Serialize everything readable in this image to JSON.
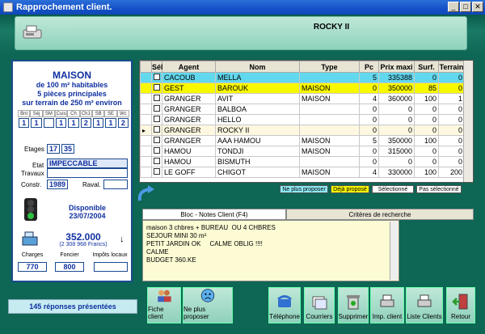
{
  "window": {
    "title": "Rapprochement client.",
    "min": "_",
    "max": "□",
    "close": "✕"
  },
  "header": {
    "title": "ROCKY II"
  },
  "property": {
    "type": "MAISON",
    "line1": "de 100 m² habitables",
    "line2": "5 pièces principales",
    "line3": "sur terrain de 250 m² environ",
    "room_headers": [
      "Bnt",
      "Séj",
      "SM",
      "Cuis",
      "Ch",
      "Ch1",
      "SB",
      "SE",
      "Wc"
    ],
    "room_values": [
      "1",
      "1",
      "",
      "1",
      "1",
      "2",
      "1",
      "1",
      "2"
    ],
    "etages_label": "Etages",
    "etages": [
      "17",
      "35"
    ],
    "etat_label": "Etat",
    "etat": "IMPECCABLE",
    "travaux_label": "Travaux",
    "constr_label": "Constr.",
    "constr": "1989",
    "raval_label": "Raval.",
    "dispo_label": "Disponible",
    "dispo_date": "23/07/2004",
    "price": "352.000",
    "price_francs": "(2 308 968 Francs)",
    "charges_label": "Charges",
    "charges": "770",
    "foncier_label": "Foncier",
    "foncier": "800",
    "impots_label": "Impôts locaux",
    "impots": ""
  },
  "grid": {
    "columns": [
      "Sél",
      "Agent",
      "Nom",
      "Type",
      "Pc",
      "Prix maxi",
      "Surf.",
      "Terrain"
    ],
    "rows": [
      {
        "agent": "CACOUB",
        "nom": "MELLA",
        "type": "",
        "pc": "5",
        "prix": "335388",
        "surf": "0",
        "terrain": "0",
        "bg": "#62d8ee"
      },
      {
        "agent": "GEST",
        "nom": "BAROUK",
        "type": "MAISON",
        "pc": "0",
        "prix": "350000",
        "surf": "85",
        "terrain": "0",
        "bg": "#f8f800"
      },
      {
        "agent": "GRANGER",
        "nom": "AVIT",
        "type": "MAISON",
        "pc": "4",
        "prix": "360000",
        "surf": "100",
        "terrain": "1",
        "bg": "#ffffff"
      },
      {
        "agent": "GRANGER",
        "nom": "BALBOA",
        "type": "",
        "pc": "0",
        "prix": "0",
        "surf": "0",
        "terrain": "0",
        "bg": "#ffffff"
      },
      {
        "agent": "GRANGER",
        "nom": "HELLO",
        "type": "",
        "pc": "0",
        "prix": "0",
        "surf": "0",
        "terrain": "0",
        "bg": "#ffffff"
      },
      {
        "agent": "GRANGER",
        "nom": "ROCKY II",
        "type": "",
        "pc": "0",
        "prix": "0",
        "surf": "0",
        "terrain": "0",
        "bg": "#fff8e0"
      },
      {
        "agent": "GRANGER",
        "nom": "AAA HAMOU",
        "type": "MAISON",
        "pc": "5",
        "prix": "350000",
        "surf": "100",
        "terrain": "0",
        "bg": "#ffffff"
      },
      {
        "agent": "HAMOU",
        "nom": "TONDJI",
        "type": "MAISON",
        "pc": "0",
        "prix": "315000",
        "surf": "0",
        "terrain": "0",
        "bg": "#ffffff"
      },
      {
        "agent": "HAMOU",
        "nom": "BISMUTH",
        "type": "",
        "pc": "0",
        "prix": "0",
        "surf": "0",
        "terrain": "0",
        "bg": "#ffffff"
      },
      {
        "agent": "LE GOFF",
        "nom": "CHIGOT",
        "type": "MAISON",
        "pc": "4",
        "prix": "330000",
        "surf": "100",
        "terrain": "200",
        "bg": "#ffffff"
      }
    ]
  },
  "legend": {
    "a": "Ne plus proposer",
    "b": "Déjà proposé",
    "c": "Sélectionné",
    "d": "Pas sélectionné"
  },
  "tabs": {
    "notes": "Bloc - Notes Client (F4)",
    "criteres": "Critères de recherche"
  },
  "notes": "maison 3 chbres + BUREAU  OU 4 CHBRES\nSEJOUR MINI 30 m²\nPETIT JARDIN OK     CALME OBLIG !!!!\nCALME\nBUDGET 360.KE",
  "status": "145 réponses présentées",
  "buttons": {
    "fiche": "Fiche client",
    "neplus": "Ne plus proposer",
    "tel": "Téléphone",
    "courrier": "Courriers",
    "suppr": "Supprimer",
    "imp": "Imp. client",
    "liste": "Liste Clients",
    "retour": "Retour"
  },
  "colors": {
    "accent": "#1030a0",
    "background": "#0e6654",
    "panel": "#bfe8d8"
  }
}
